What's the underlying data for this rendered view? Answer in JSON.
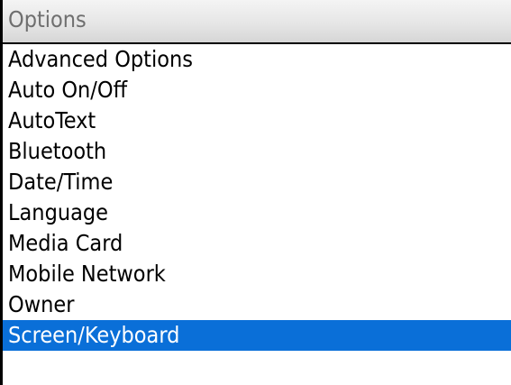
{
  "window": {
    "title": "Options"
  },
  "menu": {
    "items": [
      {
        "label": "Advanced Options"
      },
      {
        "label": "Auto On/Off"
      },
      {
        "label": "AutoText"
      },
      {
        "label": "Bluetooth"
      },
      {
        "label": "Date/Time"
      },
      {
        "label": "Language"
      },
      {
        "label": "Media Card"
      },
      {
        "label": "Mobile Network"
      },
      {
        "label": "Owner"
      },
      {
        "label": "Screen/Keyboard",
        "selected": true
      }
    ]
  },
  "colors": {
    "selection": "#0a6fd8",
    "title_text": "#6f6f6f",
    "background": "#ffffff"
  }
}
